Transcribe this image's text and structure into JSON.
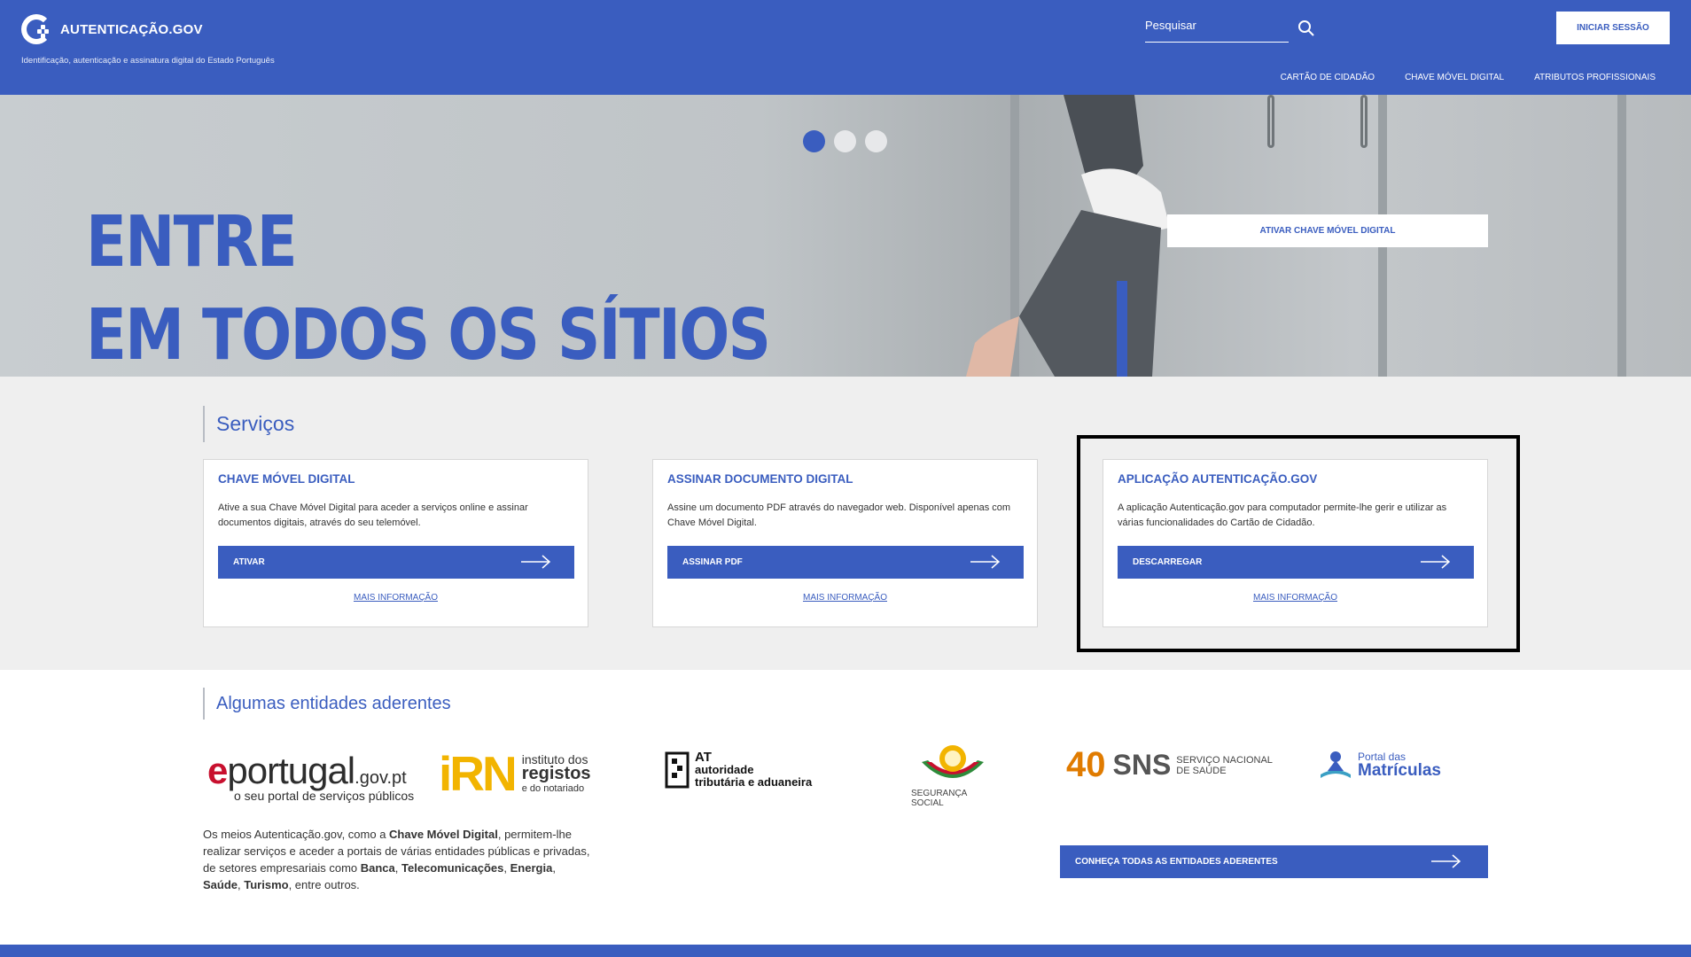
{
  "header": {
    "brand": "AUTENTICAÇÃO.GOV",
    "tagline": "Identificação, autenticação e assinatura digital do Estado Português",
    "search_placeholder": "Pesquisar",
    "login_label": "INICIAR SESSÃO",
    "nav": [
      "CARTÃO DE CIDADÃO",
      "CHAVE MÓVEL DIGITAL",
      "ATRIBUTOS PROFISSIONAIS"
    ]
  },
  "hero": {
    "line1": "ENTRE",
    "line2": "EM TODOS OS SÍTIOS",
    "cta_label": "ATIVAR CHAVE MÓVEL DIGITAL",
    "slides": 3,
    "active_slide": 1
  },
  "services": {
    "title": "Serviços",
    "cards": [
      {
        "title": "CHAVE MÓVEL DIGITAL",
        "description": "Ative a sua Chave Móvel Digital para aceder a serviços online e assinar documentos digitais, através do seu telemóvel.",
        "button": "ATIVAR",
        "more": "MAIS INFORMAÇÃO"
      },
      {
        "title": "ASSINAR DOCUMENTO DIGITAL",
        "description": "Assine um documento PDF através do navegador web. Disponível apenas com Chave Móvel Digital.",
        "button": "ASSINAR PDF",
        "more": "MAIS INFORMAÇÃO"
      },
      {
        "title": "APLICAÇÃO AUTENTICAÇÃO.GOV",
        "description": "A aplicação Autenticação.gov para computador permite-lhe gerir e utilizar as várias funcionalidades do Cartão de Cidadão.",
        "button": "DESCARREGAR",
        "more": "MAIS INFORMAÇÃO"
      }
    ]
  },
  "entities": {
    "title": "Algumas entidades aderentes",
    "logos": {
      "eportugal_main": "portugal",
      "eportugal_gov": ".gov.pt",
      "eportugal_sub": "o seu portal de serviços públicos",
      "irn_line1": "instituto dos",
      "irn_line2": "registos",
      "irn_line3": "e do notariado",
      "at_line1": "AT",
      "at_line2": "autoridade",
      "at_line3": "tributária e aduaneira",
      "ss_label": "SEGURANÇA SOCIAL",
      "sns_number": "40",
      "sns_label": "SNS",
      "sns_sub1": "SERVIÇO NACIONAL",
      "sns_sub2": "DE SAÚDE",
      "pm_line1": "Portal das",
      "pm_line2": "Matrículas"
    },
    "description_parts": {
      "p1": "Os meios Autenticação.gov, como a ",
      "b1": "Chave Móvel Digital",
      "p2": ", permitem-lhe realizar serviços e aceder a portais de várias entidades públicas e privadas, de setores empresariais como ",
      "b2": "Banca",
      "p3": ", ",
      "b3": "Telecomunicações",
      "p4": ", ",
      "b4": "Energia",
      "p5": ", ",
      "b5": "Saúde",
      "p6": ", ",
      "b6": "Turismo",
      "p7": ", entre outros."
    },
    "button": "CONHEÇA TODAS AS ENTIDADES ADERENTES"
  },
  "colors": {
    "primary": "#3a5dbf",
    "background_services": "#efefef"
  }
}
